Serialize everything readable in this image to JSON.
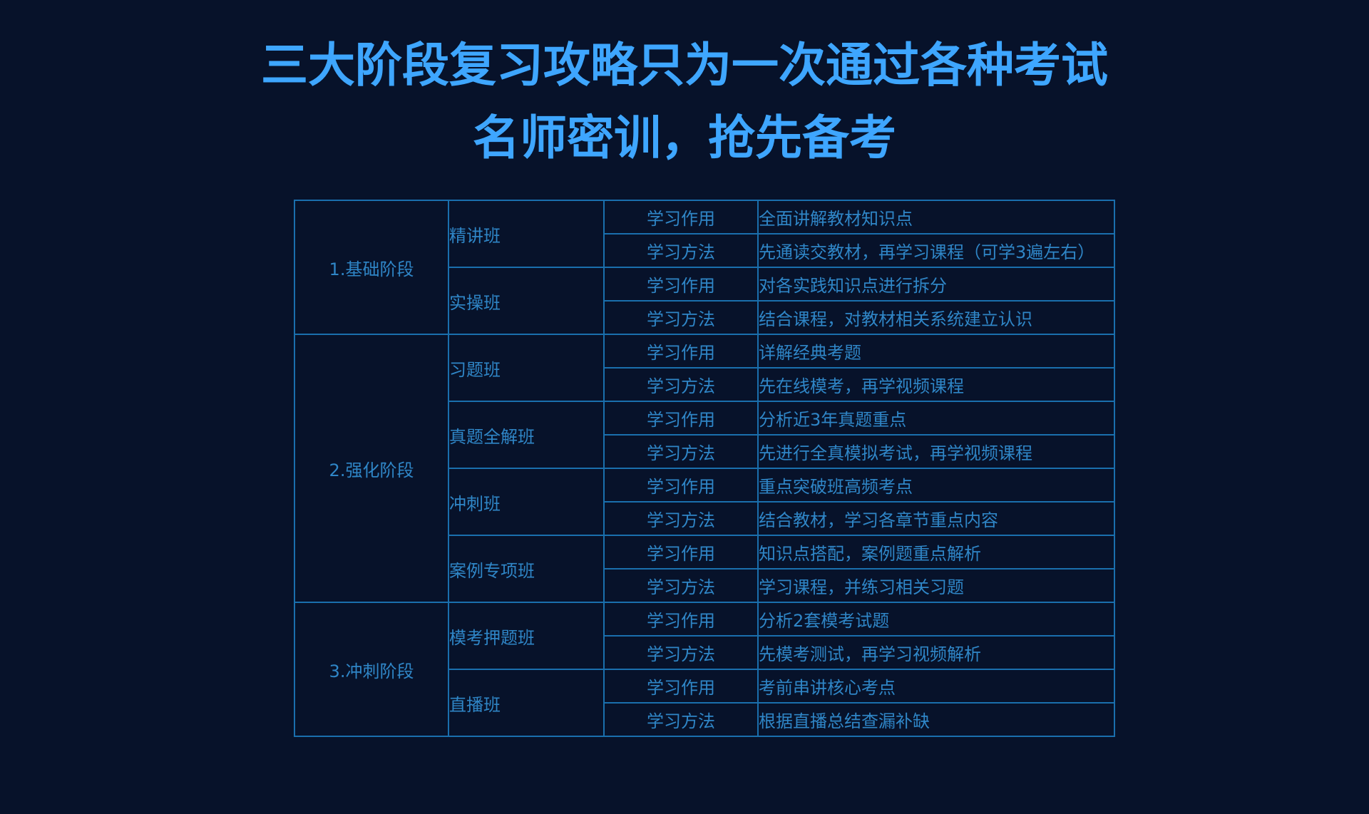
{
  "header": {
    "title_line1": "三大阶段复习攻略只为一次通过各种考试",
    "title_line2": "名师密训，抢先备考"
  },
  "stages": [
    {
      "name": "1.基础阶段",
      "classes": [
        {
          "name": "精讲班",
          "rows": [
            {
              "kind": "学习作用",
              "desc": "全面讲解教材知识点"
            },
            {
              "kind": "学习方法",
              "desc": "先通读交教材，再学习课程（可学3遍左右）"
            }
          ]
        },
        {
          "name": "实操班",
          "rows": [
            {
              "kind": "学习作用",
              "desc": "对各实践知识点进行拆分"
            },
            {
              "kind": "学习方法",
              "desc": "结合课程，对教材相关系统建立认识"
            }
          ]
        }
      ]
    },
    {
      "name": "2.强化阶段",
      "classes": [
        {
          "name": "习题班",
          "rows": [
            {
              "kind": "学习作用",
              "desc": "详解经典考题"
            },
            {
              "kind": "学习方法",
              "desc": "先在线模考，再学视频课程"
            }
          ]
        },
        {
          "name": "真题全解班",
          "rows": [
            {
              "kind": "学习作用",
              "desc": "分析近3年真题重点"
            },
            {
              "kind": "学习方法",
              "desc": "先进行全真模拟考试，再学视频课程"
            }
          ]
        },
        {
          "name": "冲刺班",
          "rows": [
            {
              "kind": "学习作用",
              "desc": "重点突破班高频考点"
            },
            {
              "kind": "学习方法",
              "desc": "结合教材，学习各章节重点内容"
            }
          ]
        },
        {
          "name": "案例专项班",
          "rows": [
            {
              "kind": "学习作用",
              "desc": "知识点搭配，案例题重点解析"
            },
            {
              "kind": "学习方法",
              "desc": "学习课程，并练习相关习题"
            }
          ]
        }
      ]
    },
    {
      "name": "3.冲刺阶段",
      "classes": [
        {
          "name": "模考押题班",
          "rows": [
            {
              "kind": "学习作用",
              "desc": "分析2套模考试题"
            },
            {
              "kind": "学习方法",
              "desc": "先模考测试，再学习视频解析"
            }
          ]
        },
        {
          "name": "直播班",
          "rows": [
            {
              "kind": "学习作用",
              "desc": "考前串讲核心考点"
            },
            {
              "kind": "学习方法",
              "desc": "根据直播总结查漏补缺"
            }
          ]
        }
      ]
    }
  ]
}
